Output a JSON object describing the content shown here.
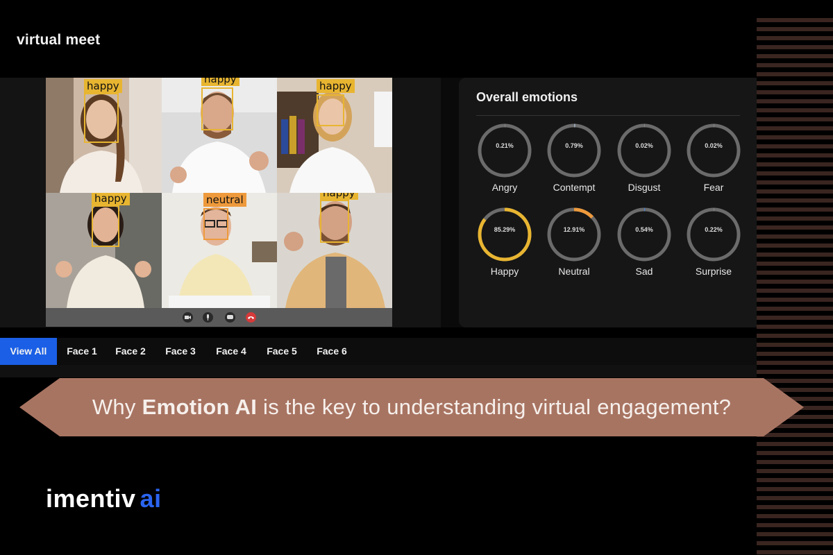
{
  "app": {
    "title": "virtual meet"
  },
  "video": {
    "tiles": [
      {
        "label": "happy",
        "kind": "happy"
      },
      {
        "label": "happy",
        "kind": "happy"
      },
      {
        "label": "happy",
        "kind": "happy"
      },
      {
        "label": "happy",
        "kind": "happy"
      },
      {
        "label": "neutral",
        "kind": "neutral"
      },
      {
        "label": "happy",
        "kind": "happy"
      }
    ],
    "controls": [
      "camera-icon",
      "microphone-icon",
      "chat-icon",
      "end-call-icon"
    ]
  },
  "emotions": {
    "title": "Overall emotions",
    "items": [
      {
        "name": "Angry",
        "value": "0.21%",
        "fraction": 0.0021,
        "color": "#888888"
      },
      {
        "name": "Contempt",
        "value": "0.79%",
        "fraction": 0.0079,
        "color": "#9aa6b6"
      },
      {
        "name": "Disgust",
        "value": "0.02%",
        "fraction": 0.0002,
        "color": "#888888"
      },
      {
        "name": "Fear",
        "value": "0.02%",
        "fraction": 0.0002,
        "color": "#888888"
      },
      {
        "name": "Happy",
        "value": "85.29%",
        "fraction": 0.8529,
        "color": "#e8b531"
      },
      {
        "name": "Neutral",
        "value": "12.91%",
        "fraction": 0.1291,
        "color": "#ee9a3c"
      },
      {
        "name": "Sad",
        "value": "0.54%",
        "fraction": 0.0054,
        "color": "#4a7fd0"
      },
      {
        "name": "Surprise",
        "value": "0.22%",
        "fraction": 0.0022,
        "color": "#888888"
      }
    ]
  },
  "tabs": [
    "View All",
    "Face 1",
    "Face 2",
    "Face 3",
    "Face 4",
    "Face 5",
    "Face 6"
  ],
  "banner": {
    "prefix": "Why ",
    "highlight": "Emotion AI",
    "suffix": " is the key to understanding virtual engagement?"
  },
  "brand": {
    "name": "imentiv",
    "suffix": "ai"
  },
  "colors": {
    "accent": "#1a5fe6",
    "banner": "#a87462",
    "happy": "#e8b531",
    "neutral": "#ee9a3c",
    "brand_ai": "#2a64f0"
  }
}
